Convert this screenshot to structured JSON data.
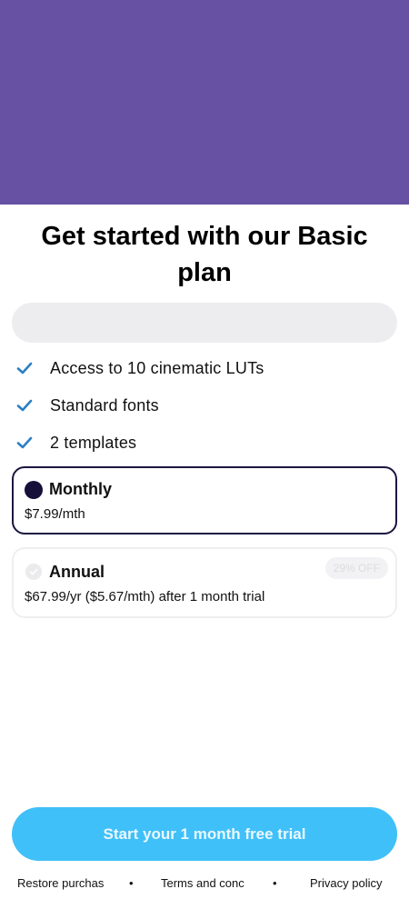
{
  "header": {
    "title": "Get started with our Basic plan"
  },
  "features": [
    {
      "icon": "check-icon",
      "label": "Access to 10 cinematic LUTs"
    },
    {
      "icon": "check-icon",
      "label": "Standard fonts"
    },
    {
      "icon": "check-icon",
      "label": "2 templates"
    }
  ],
  "plans": {
    "monthly": {
      "name": "Monthly",
      "price": "$7.99/mth",
      "selected": true
    },
    "annual": {
      "name": "Annual",
      "price": "$67.99/yr ($5.67/mth) after 1 month trial",
      "badge": "29% OFF",
      "selected": false
    }
  },
  "cta": {
    "label": "Start your 1 month free trial"
  },
  "footer": {
    "restore": "Restore purchas",
    "terms": "Terms and conc",
    "privacy": "Privacy policy",
    "separator": "•"
  },
  "colors": {
    "hero": "#6651a3",
    "accent": "#40c0f8",
    "check": "#2b7fc3",
    "selected_border": "#1a1640"
  }
}
